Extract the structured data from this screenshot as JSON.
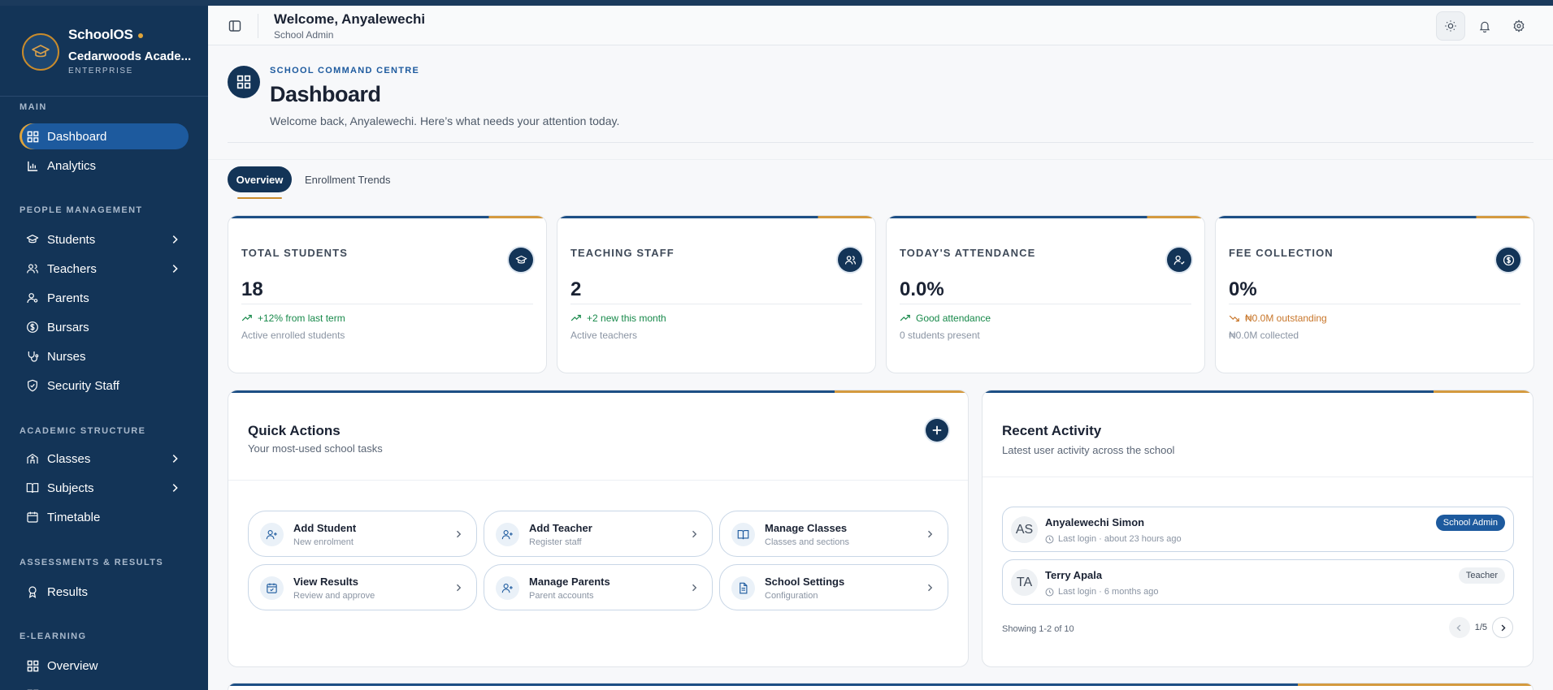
{
  "sidebar": {
    "brand": {
      "name": "SchoolOS",
      "school": "Cedarwoods Acade...",
      "tier": "ENTERPRISE"
    },
    "sections": {
      "main": "MAIN",
      "people": "PEOPLE MANAGEMENT",
      "academic": "ACADEMIC STRUCTURE",
      "assessments": "ASSESSMENTS & RESULTS",
      "elearning": "E-LEARNING"
    },
    "items": {
      "dashboard": "Dashboard",
      "analytics": "Analytics",
      "students": "Students",
      "teachers": "Teachers",
      "parents": "Parents",
      "bursars": "Bursars",
      "nurses": "Nurses",
      "security": "Security Staff",
      "classes": "Classes",
      "subjects": "Subjects",
      "timetable": "Timetable",
      "results": "Results",
      "overview": "Overview"
    }
  },
  "header": {
    "title": "Welcome, Anyalewechi",
    "subtitle": "School Admin"
  },
  "page": {
    "eyebrow": "SCHOOL COMMAND CENTRE",
    "title": "Dashboard",
    "subtitle": "Welcome back, Anyalewechi. Here’s what needs your attention today."
  },
  "tabs": {
    "overview": "Overview",
    "enrollment": "Enrollment Trends"
  },
  "stats": [
    {
      "label": "TOTAL STUDENTS",
      "value": "18",
      "trend": "+12% from last term",
      "foot": "Active enrolled students",
      "icon": "graduation-cap-icon"
    },
    {
      "label": "TEACHING STAFF",
      "value": "2",
      "trend": "+2 new this month",
      "foot": "Active teachers",
      "icon": "users-icon"
    },
    {
      "label": "TODAY'S ATTENDANCE",
      "value": "0.0%",
      "trend": "Good attendance",
      "foot": "0 students present",
      "icon": "user-check-icon"
    },
    {
      "label": "FEE COLLECTION",
      "value": "0%",
      "trend": "₦0.0M outstanding",
      "foot": "₦0.0M collected",
      "icon": "dollar-icon"
    }
  ],
  "quick_actions": {
    "title": "Quick Actions",
    "subtitle": "Your most-used school tasks",
    "items": [
      {
        "title": "Add Student",
        "sub": "New enrolment"
      },
      {
        "title": "Add Teacher",
        "sub": "Register staff"
      },
      {
        "title": "Manage Classes",
        "sub": "Classes and sections"
      },
      {
        "title": "View Results",
        "sub": "Review and approve"
      },
      {
        "title": "Manage Parents",
        "sub": "Parent accounts"
      },
      {
        "title": "School Settings",
        "sub": "Configuration"
      }
    ]
  },
  "activity": {
    "title": "Recent Activity",
    "subtitle": "Latest user activity across the school",
    "rows": [
      {
        "initials": "AS",
        "name": "Anyalewechi Simon",
        "meta": "Last login · about 23 hours ago",
        "role": "School Admin"
      },
      {
        "initials": "TA",
        "name": "Terry Apala",
        "meta": "Last login · 6 months ago",
        "role": "Teacher"
      }
    ],
    "footer": "Showing 1-2 of 10",
    "page": "1/5"
  },
  "colors": {
    "navy": "#133457",
    "accent_blue": "#1d5a9e",
    "gold": "#d49a3f",
    "success": "#17894a",
    "warning": "#c8762a"
  }
}
